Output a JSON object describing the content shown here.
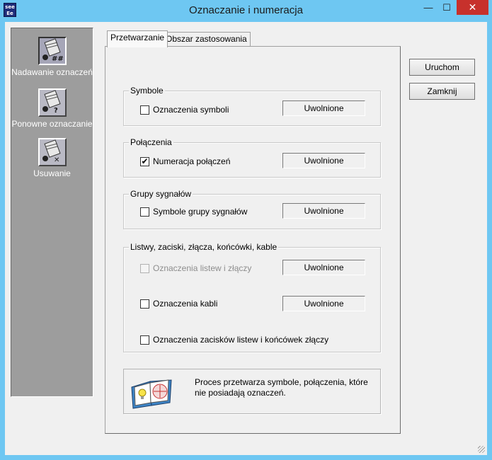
{
  "window": {
    "title": "Oznaczanie i numeracja",
    "icon_text_top": "see",
    "icon_text_bottom": "Ee",
    "min_glyph": "—",
    "max_glyph": "☐",
    "close_glyph": "✕"
  },
  "sidebar": {
    "items": [
      {
        "label": "Nadawanie oznaczeń",
        "icon": "numbering-icon",
        "glyph": "##"
      },
      {
        "label": "Ponowne oznaczanie",
        "icon": "renumbering-icon",
        "glyph": "?"
      },
      {
        "label": "Usuwanie",
        "icon": "delete-markings-icon",
        "glyph": "✕"
      }
    ]
  },
  "tabs": [
    {
      "label": "Przetwarzanie",
      "active": true
    },
    {
      "label": "Obszar zastosowania",
      "active": false
    }
  ],
  "groups": {
    "symbole": {
      "legend": "Symbole",
      "checkbox_label": "Oznaczenia symboli",
      "checked": false,
      "status": "Uwolnione"
    },
    "polaczenia": {
      "legend": "Połączenia",
      "checkbox_label": "Numeracja połączeń",
      "checked": true,
      "check_glyph": "✔",
      "status": "Uwolnione"
    },
    "grupy": {
      "legend": "Grupy sygnałów",
      "checkbox_label": "Symbole grupy sygnałów",
      "checked": false,
      "status": "Uwolnione"
    },
    "listwy": {
      "legend": "Listwy, zaciski, złącza, końcówki, kable",
      "items": [
        {
          "label": "Oznaczenia listew i złączy",
          "checked": false,
          "disabled": true,
          "status": "Uwolnione"
        },
        {
          "label": "Oznaczenia kabli",
          "checked": false,
          "disabled": false,
          "status": "Uwolnione"
        },
        {
          "label": "Oznaczenia zacisków listew i końcówek złączy",
          "checked": false,
          "disabled": false
        }
      ]
    }
  },
  "tip": {
    "icon": "tip-of-the-day-book-icon",
    "text": "Proces przetwarza symbole, połączenia, które nie posiadają oznaczeń."
  },
  "buttons": {
    "run": "Uruchom",
    "close": "Zamknij"
  },
  "colors": {
    "titlebar": "#6ec7f2",
    "close_button": "#c7312c",
    "sidebar": "#9d9d9d"
  }
}
